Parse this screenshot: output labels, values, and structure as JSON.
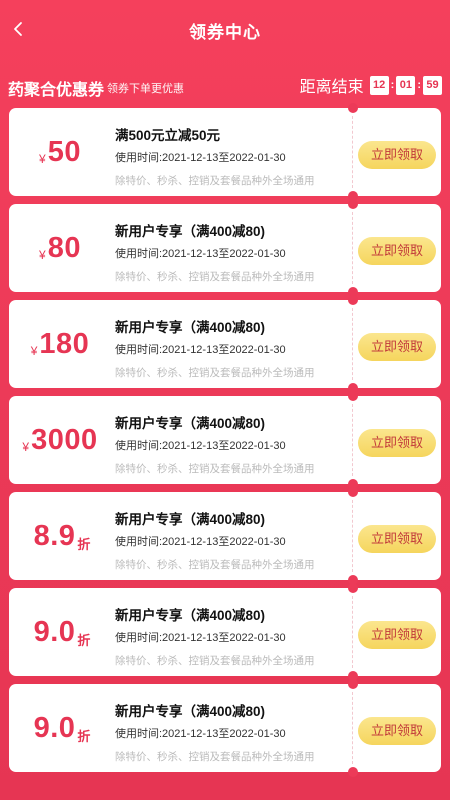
{
  "header": {
    "title": "领券中心",
    "back_icon": "chevron-left-icon"
  },
  "section": {
    "title": "药聚合优惠券",
    "subtitle": "领券下单更优惠",
    "countdown": {
      "label": "距离结束",
      "hours": "12",
      "minutes": "01",
      "seconds": "59",
      "separator": ":"
    }
  },
  "colors": {
    "accent": "#e63553",
    "background": "#ec3a58",
    "button": "#f5d55d"
  },
  "coupons": [
    {
      "currency": "¥",
      "amount": "50",
      "unit": "",
      "title": "满500元立减50元",
      "time": "使用时间:2021-12-13至2022-01-30",
      "note": "除特价、秒杀、控销及套餐品种外全场通用",
      "button": "立即领取"
    },
    {
      "currency": "¥",
      "amount": "80",
      "unit": "",
      "title": "新用户专享（满400减80)",
      "time": "使用时间:2021-12-13至2022-01-30",
      "note": "除特价、秒杀、控销及套餐品种外全场通用",
      "button": "立即领取"
    },
    {
      "currency": "¥",
      "amount": "180",
      "unit": "",
      "title": "新用户专享（满400减80)",
      "time": "使用时间:2021-12-13至2022-01-30",
      "note": "除特价、秒杀、控销及套餐品种外全场通用",
      "button": "立即领取"
    },
    {
      "currency": "¥",
      "amount": "3000",
      "unit": "",
      "title": "新用户专享（满400减80)",
      "time": "使用时间:2021-12-13至2022-01-30",
      "note": "除特价、秒杀、控销及套餐品种外全场通用",
      "button": "立即领取"
    },
    {
      "currency": "",
      "amount": "8.9",
      "unit": "折",
      "title": "新用户专享（满400减80)",
      "time": "使用时间:2021-12-13至2022-01-30",
      "note": "除特价、秒杀、控销及套餐品种外全场通用",
      "button": "立即领取"
    },
    {
      "currency": "",
      "amount": "9.0",
      "unit": "折",
      "title": "新用户专享（满400减80)",
      "time": "使用时间:2021-12-13至2022-01-30",
      "note": "除特价、秒杀、控销及套餐品种外全场通用",
      "button": "立即领取"
    },
    {
      "currency": "",
      "amount": "9.0",
      "unit": "折",
      "title": "新用户专享（满400减80)",
      "time": "使用时间:2021-12-13至2022-01-30",
      "note": "除特价、秒杀、控销及套餐品种外全场通用",
      "button": "立即领取"
    }
  ]
}
